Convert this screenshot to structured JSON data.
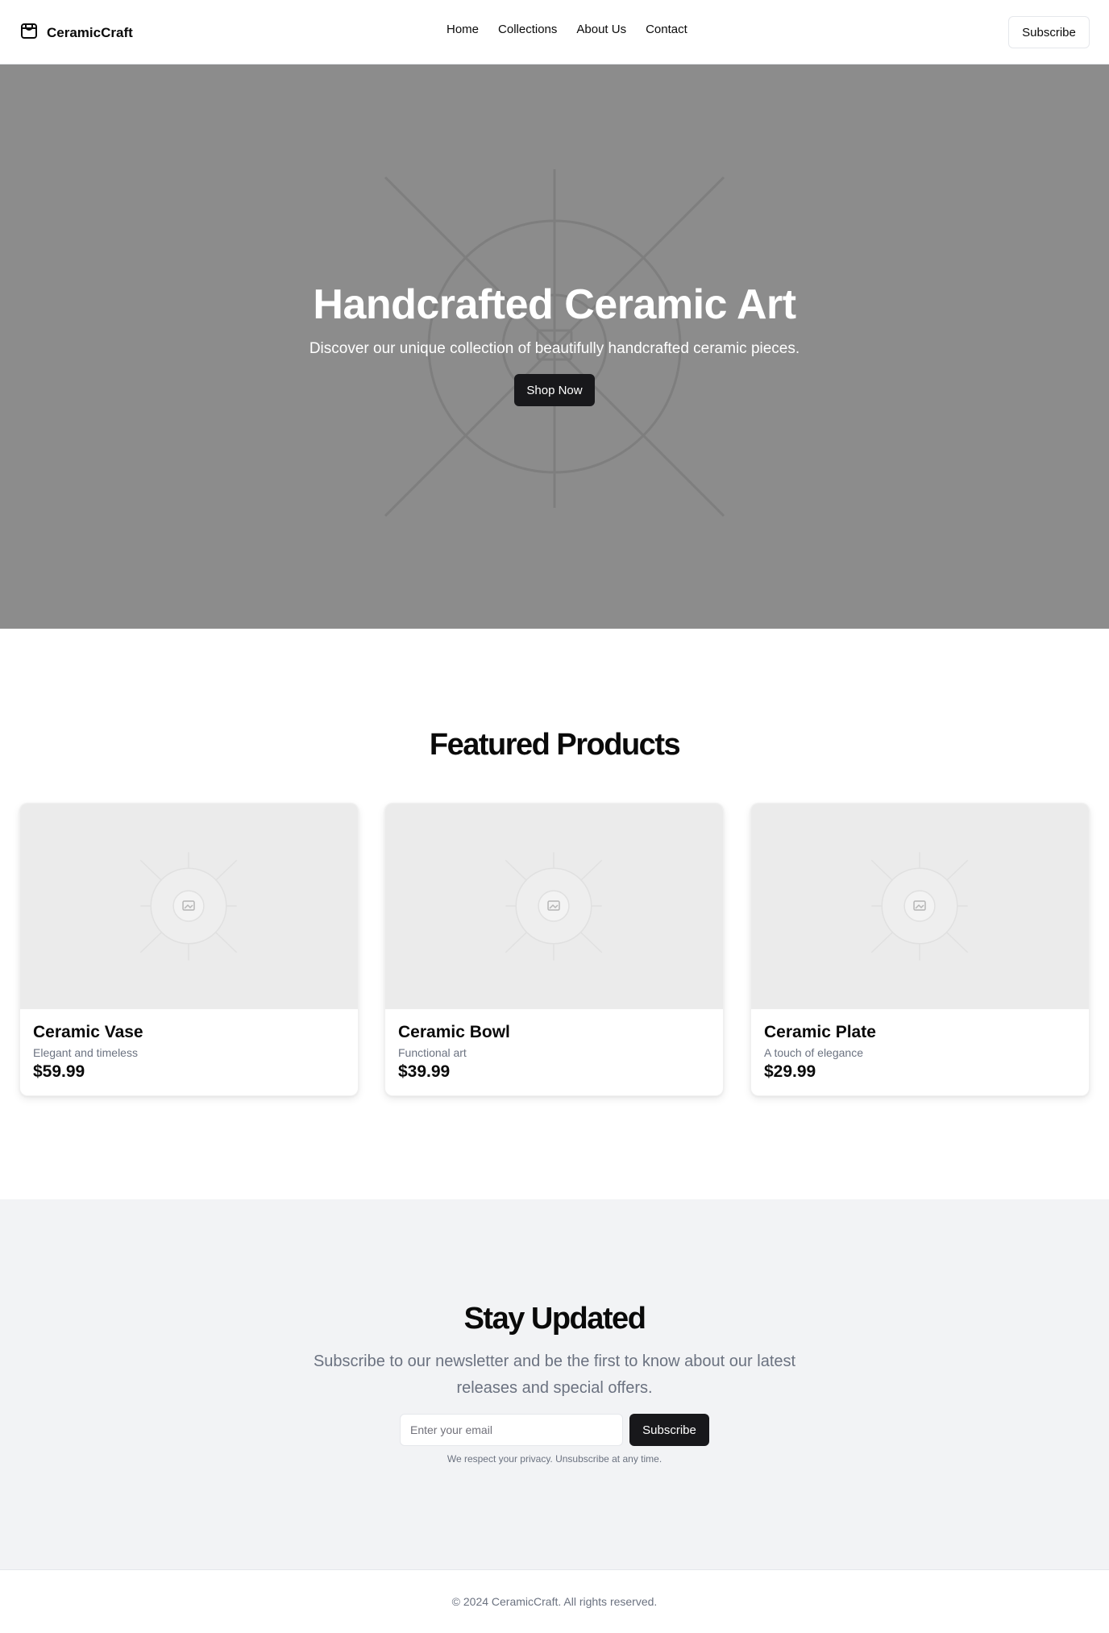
{
  "header": {
    "brand": "CeramicCraft",
    "brand_icon": "store-icon",
    "nav": [
      "Home",
      "Collections",
      "About Us",
      "Contact"
    ],
    "subscribe_label": "Subscribe"
  },
  "hero": {
    "title": "Handcrafted Ceramic Art",
    "subtitle": "Discover our unique collection of beautifully handcrafted ceramic pieces.",
    "cta_label": "Shop Now",
    "background_color": "#8c8c8c",
    "image_icon": "image-placeholder-icon"
  },
  "featured": {
    "title": "Featured Products",
    "products": [
      {
        "name": "Ceramic Vase",
        "description": "Elegant and timeless",
        "price": "$59.99"
      },
      {
        "name": "Ceramic Bowl",
        "description": "Functional art",
        "price": "$39.99"
      },
      {
        "name": "Ceramic Plate",
        "description": "A touch of elegance",
        "price": "$29.99"
      }
    ]
  },
  "newsletter": {
    "title": "Stay Updated",
    "subtitle": "Subscribe to our newsletter and be the first to know about our latest releases and special offers.",
    "email_placeholder": "Enter your email",
    "subscribe_label": "Subscribe",
    "note": "We respect your privacy. Unsubscribe at any time."
  },
  "footer": {
    "copyright": "© 2024 CeramicCraft. All rights reserved."
  },
  "colors": {
    "primary_button": "#18181b",
    "muted_text": "#6b7280",
    "section_bg": "#f2f3f5"
  }
}
